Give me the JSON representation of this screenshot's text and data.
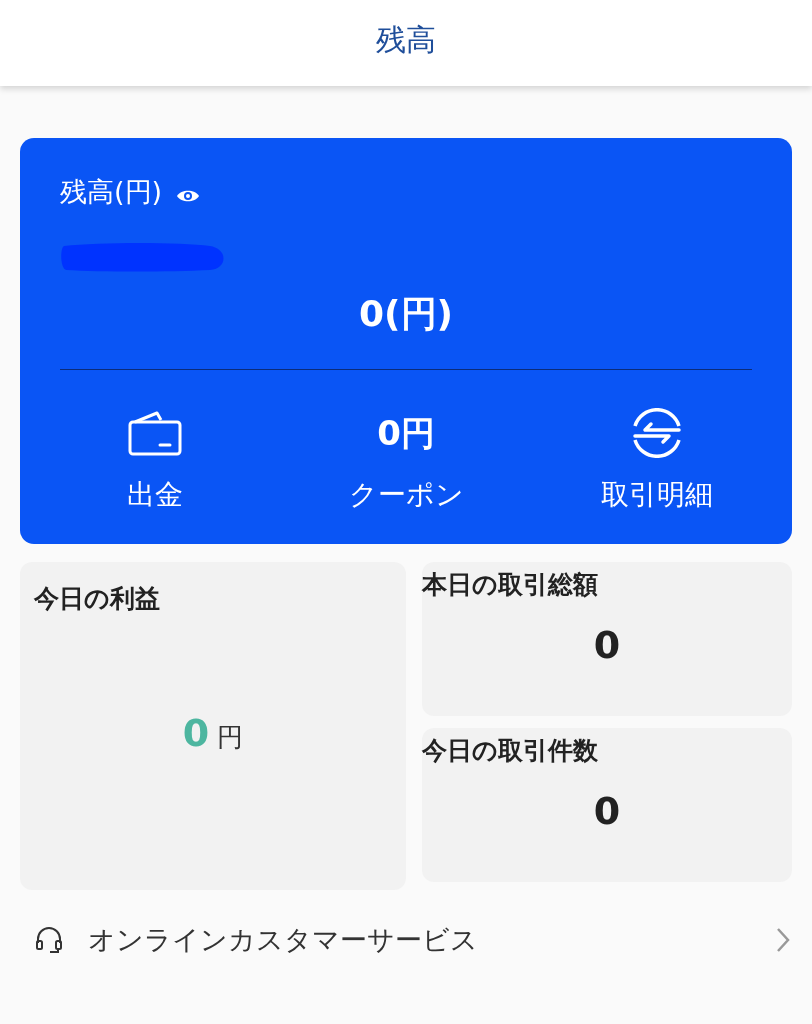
{
  "header": {
    "title": "残高"
  },
  "balance_card": {
    "label": "残高(円)",
    "amount": "0(円)",
    "actions": [
      {
        "kind": "wallet",
        "label": "出金"
      },
      {
        "kind": "value",
        "value": "0円",
        "label": "クーポン"
      },
      {
        "kind": "exchange",
        "label": "取引明細"
      }
    ]
  },
  "profit": {
    "title": "今日の利益",
    "value": "0",
    "unit": "円"
  },
  "stats": [
    {
      "title": "本日の取引総額",
      "value": "0"
    },
    {
      "title": "今日の取引件数",
      "value": "0"
    }
  ],
  "service_link": {
    "label": "オンラインカスタマーサービス"
  }
}
